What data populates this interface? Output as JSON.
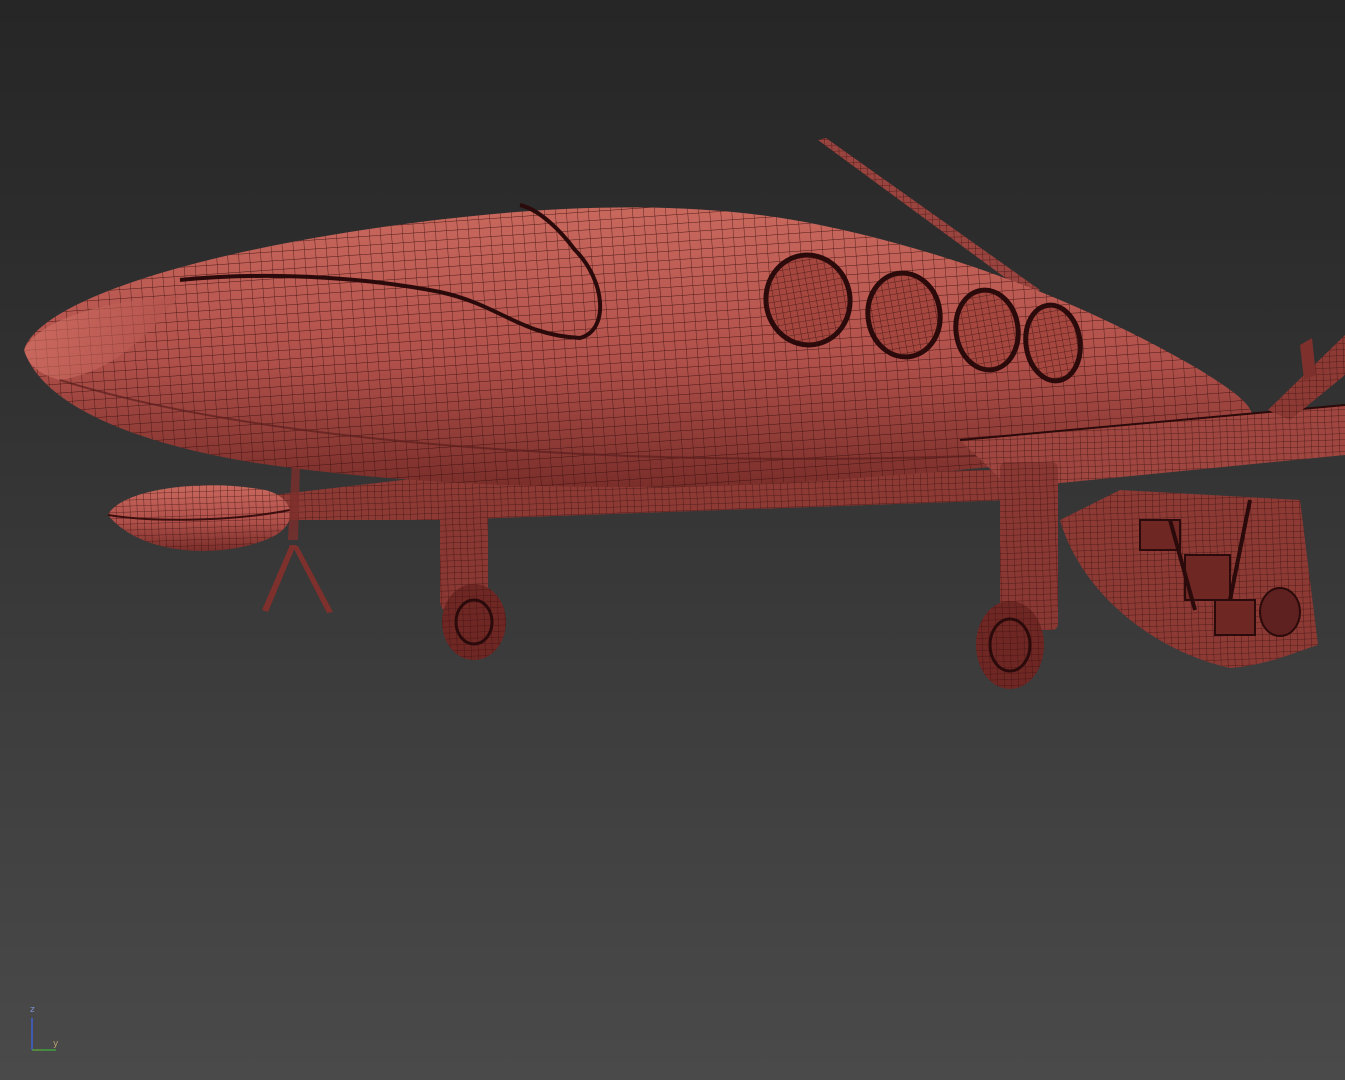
{
  "viewport": {
    "background_top": "#262626",
    "background_bottom": "#4a4a4a",
    "model": {
      "name": "electric-aircraft-wireframe",
      "shading": "edged-faces",
      "surface_color": "#b0504a",
      "surface_light_color": "#c9685d",
      "edge_color": "#3a0f0e"
    },
    "axis_gizmo": {
      "z_label": "z",
      "y_label": "y",
      "z_color": "#4060d0",
      "x_color": "#c03030",
      "y_color": "#40a040"
    }
  }
}
